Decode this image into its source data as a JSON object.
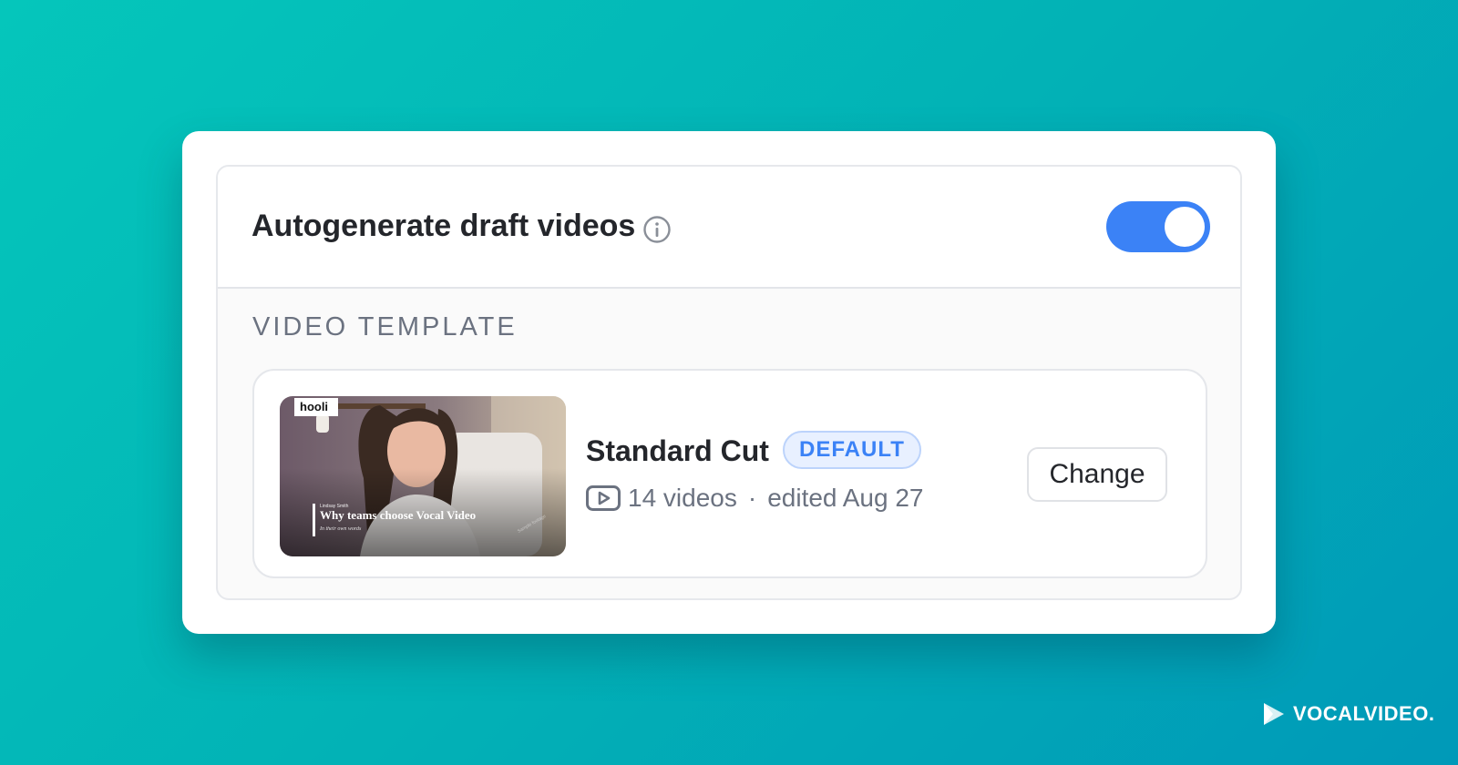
{
  "setting": {
    "title": "Autogenerate draft videos",
    "enabled": true
  },
  "section": {
    "label": "VIDEO TEMPLATE"
  },
  "template": {
    "name": "Standard Cut",
    "badge": "DEFAULT",
    "video_count": "14 videos",
    "separator": "·",
    "edited": "edited Aug 27",
    "change_label": "Change",
    "thumbnail": {
      "logo_text": "hooli",
      "speaker_name": "Lindsay Smith",
      "headline": "Why teams choose Vocal Video",
      "subheadline": "In their own words",
      "watermark": "Sample footage"
    }
  },
  "brand": {
    "wordmark": "VOCALVIDEO."
  },
  "colors": {
    "accent": "#3b82f6",
    "background_start": "#05c6bb",
    "background_end": "#0099b8"
  },
  "icons": [
    "info-icon",
    "video-icon",
    "brand-play-icon"
  ]
}
